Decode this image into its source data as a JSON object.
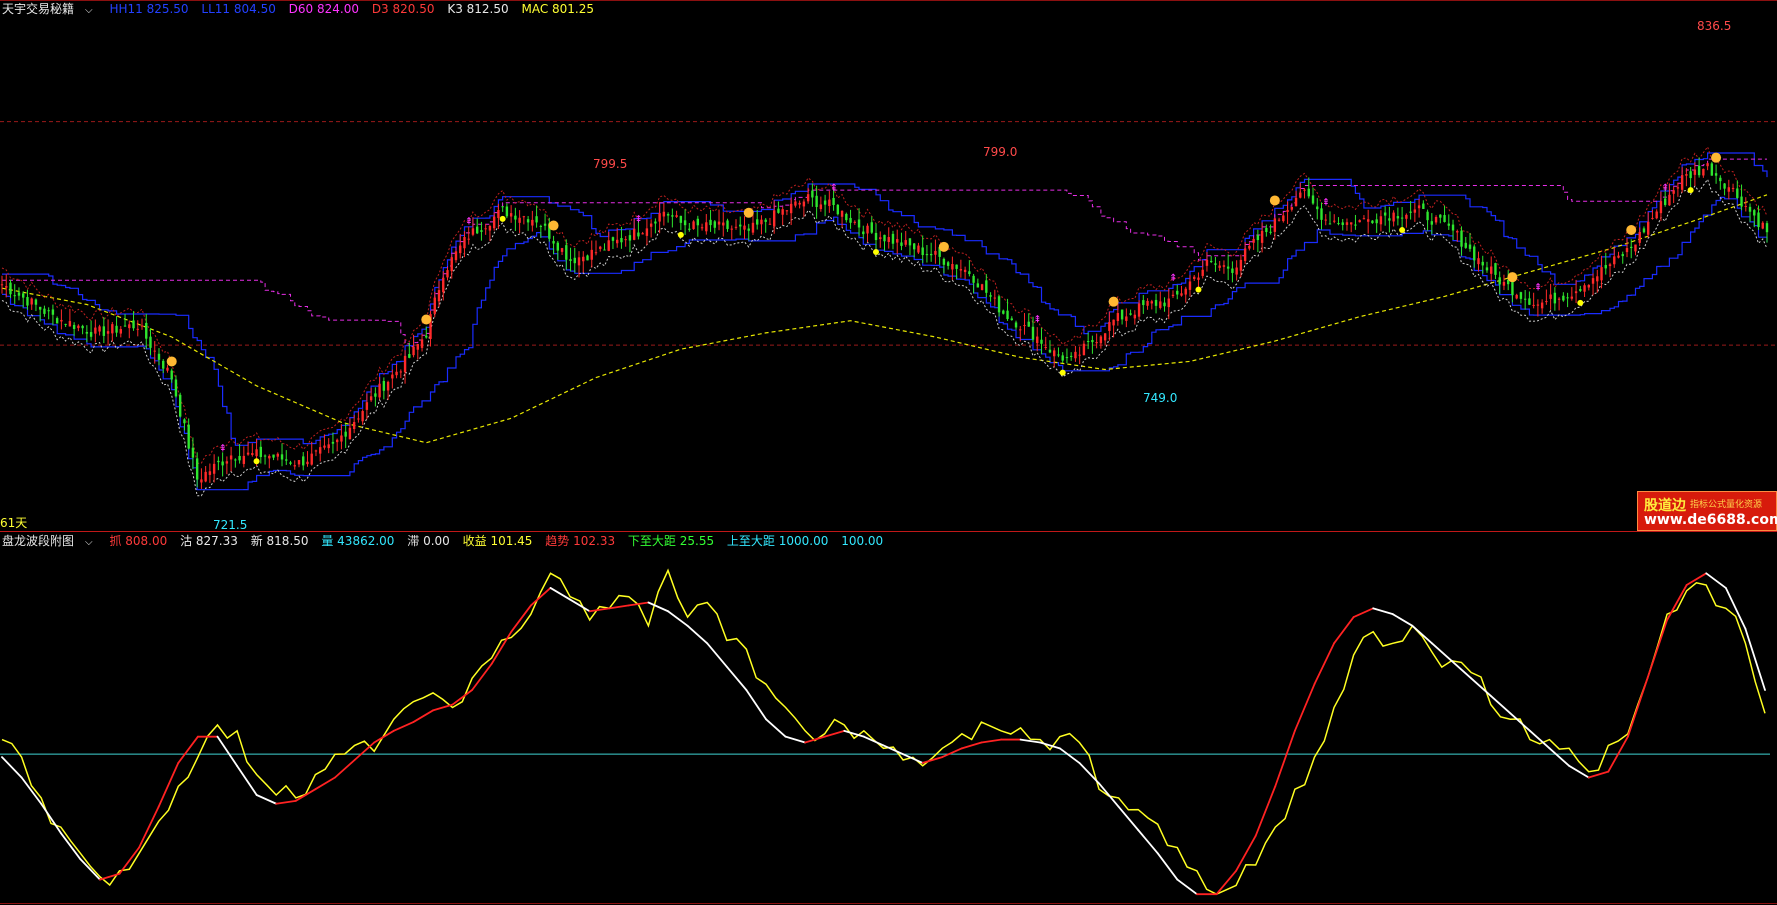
{
  "price_panel": {
    "title": "天宇交易秘籍",
    "indicators": [
      {
        "text": "HH11 825.50",
        "color": "#2340ff"
      },
      {
        "text": "LL11 804.50",
        "color": "#2340ff"
      },
      {
        "text": "D60 824.00",
        "color": "#ff33ff"
      },
      {
        "text": "D3 820.50",
        "color": "#ff3a3a"
      },
      {
        "text": "K3 812.50",
        "color": "#e8e8e8"
      },
      {
        "text": "MAC 801.25",
        "color": "#ffff33"
      }
    ],
    "price_labels": {
      "high_right": "836.5",
      "high_left": "799.5",
      "high_mid": "799.0",
      "low_mid": "749.0",
      "low_left": "721.5",
      "days": "61天"
    }
  },
  "indicator_panel": {
    "title": "盘龙波段附图",
    "indicators": [
      {
        "text": "抓 808.00",
        "color": "#ff3a3a"
      },
      {
        "text": "沽 827.33",
        "color": "#e8e8e8"
      },
      {
        "text": "新 818.50",
        "color": "#e8e8e8"
      },
      {
        "text": "量 43862.00",
        "color": "#33e8ff"
      },
      {
        "text": "滞 0.00",
        "color": "#e8e8e8"
      },
      {
        "text": "收益 101.45",
        "color": "#ffff33"
      },
      {
        "text": "趋势 102.33",
        "color": "#ff3a3a"
      },
      {
        "text": "下至大距 25.55",
        "color": "#33ff33"
      },
      {
        "text": "上至大距 1000.00",
        "color": "#33e8ff"
      },
      {
        "text": "100.00",
        "color": "#33e8ff"
      }
    ]
  },
  "watermark": {
    "brand": "股道边",
    "tagline": "指标公式量化资源",
    "url": "www.de6688.com"
  },
  "colors": {
    "background": "#000000",
    "up": "#ff2a2a",
    "down": "#2ee62e",
    "channel": "#1a2cff",
    "long_ma": "#e6e600",
    "d60": "#e62ee6",
    "indicator_fast": "#ffff22",
    "indicator_slow_up": "#ff2222",
    "indicator_slow_down": "#ffffff",
    "reference": "#3fd4d4"
  },
  "chart_data": [
    {
      "type": "line",
      "subtype": "candlestick",
      "ylim": [
        715,
        840
      ],
      "y_reference_lines": [
        815,
        760
      ],
      "marked_highs": [
        836.5,
        799.5,
        799.0
      ],
      "marked_lows": [
        721.5,
        749.0
      ],
      "series": [
        {
          "name": "HH11",
          "last": 825.5
        },
        {
          "name": "LL11",
          "last": 804.5
        },
        {
          "name": "D60",
          "last": 824.0
        },
        {
          "name": "D3",
          "last": 820.5
        },
        {
          "name": "K3",
          "last": 812.5
        },
        {
          "name": "MAC",
          "last": 801.25
        }
      ],
      "price_path": [
        [
          0,
          775
        ],
        [
          12,
          767
        ],
        [
          22,
          763
        ],
        [
          32,
          765
        ],
        [
          40,
          752
        ],
        [
          46,
          727
        ],
        [
          54,
          733
        ],
        [
          62,
          733
        ],
        [
          70,
          731
        ],
        [
          78,
          735
        ],
        [
          88,
          748
        ],
        [
          96,
          757
        ],
        [
          100,
          763
        ],
        [
          104,
          778
        ],
        [
          110,
          787
        ],
        [
          118,
          793
        ],
        [
          126,
          791
        ],
        [
          134,
          781
        ],
        [
          140,
          783
        ],
        [
          150,
          788
        ],
        [
          156,
          793
        ],
        [
          160,
          790
        ],
        [
          164,
          789
        ],
        [
          170,
          789
        ],
        [
          176,
          788
        ],
        [
          184,
          793
        ],
        [
          190,
          796
        ],
        [
          196,
          794
        ],
        [
          204,
          788
        ],
        [
          212,
          785
        ],
        [
          220,
          782
        ],
        [
          228,
          778
        ],
        [
          236,
          768
        ],
        [
          244,
          762
        ],
        [
          248,
          758
        ],
        [
          252,
          756
        ],
        [
          256,
          760
        ],
        [
          262,
          766
        ],
        [
          270,
          770
        ],
        [
          276,
          771
        ],
        [
          284,
          780
        ],
        [
          290,
          779
        ],
        [
          296,
          786
        ],
        [
          300,
          790
        ],
        [
          306,
          798
        ],
        [
          312,
          791
        ],
        [
          318,
          790
        ],
        [
          326,
          792
        ],
        [
          334,
          793
        ],
        [
          342,
          788
        ],
        [
          348,
          781
        ],
        [
          354,
          775
        ],
        [
          362,
          770
        ],
        [
          370,
          773
        ],
        [
          378,
          779
        ],
        [
          384,
          784
        ],
        [
          390,
          793
        ],
        [
          396,
          801
        ],
        [
          402,
          804
        ],
        [
          408,
          798
        ],
        [
          412,
          793
        ],
        [
          416,
          788
        ]
      ],
      "ma_path": [
        [
          0,
          774
        ],
        [
          20,
          770
        ],
        [
          40,
          762
        ],
        [
          60,
          750
        ],
        [
          80,
          741
        ],
        [
          100,
          736
        ],
        [
          120,
          742
        ],
        [
          140,
          752
        ],
        [
          160,
          759
        ],
        [
          180,
          763
        ],
        [
          200,
          766
        ],
        [
          220,
          762
        ],
        [
          240,
          757
        ],
        [
          260,
          754
        ],
        [
          280,
          756
        ],
        [
          300,
          761
        ],
        [
          320,
          767
        ],
        [
          340,
          772
        ],
        [
          360,
          778
        ],
        [
          380,
          784
        ],
        [
          400,
          791
        ],
        [
          416,
          797
        ]
      ]
    },
    {
      "type": "line",
      "title": "盘龙波段附图",
      "ylim": [
        0,
        120
      ],
      "reference_line": 50,
      "series": [
        {
          "name": "fast",
          "values": [
            55,
            49,
            35,
            25,
            16,
            8,
            10,
            16,
            27,
            39,
            49,
            60,
            58,
            43,
            36,
            35,
            43,
            50,
            53,
            51,
            62,
            68,
            71,
            66,
            76,
            83,
            90,
            98,
            112,
            104,
            96,
            100,
            104,
            94,
            113,
            97,
            102,
            89,
            86,
            74,
            66,
            58,
            57,
            60,
            58,
            52,
            48,
            46,
            52,
            57,
            61,
            58,
            59,
            55,
            56,
            54,
            38,
            35,
            31,
            26,
            18,
            10,
            2,
            5,
            12,
            25,
            38,
            49,
            66,
            84,
            92,
            88,
            94,
            85,
            82,
            78,
            67,
            62,
            55,
            55,
            52,
            44,
            53,
            57,
            76,
            98,
            106,
            108,
            100,
            88,
            64
          ]
        },
        {
          "name": "slow",
          "values": [
            49,
            42,
            33,
            23,
            14,
            7,
            9,
            18,
            32,
            47,
            56,
            56,
            46,
            36,
            33,
            34,
            38,
            42,
            48,
            54,
            58,
            61,
            65,
            67,
            72,
            81,
            92,
            101,
            107,
            103,
            99,
            100,
            101,
            102,
            99,
            94,
            88,
            80,
            72,
            62,
            56,
            54,
            56,
            58,
            56,
            53,
            50,
            47,
            49,
            52,
            54,
            55,
            55,
            54,
            52,
            47,
            40,
            32,
            24,
            16,
            7,
            2,
            2,
            10,
            22,
            39,
            58,
            74,
            88,
            97,
            100,
            98,
            94,
            88,
            82,
            76,
            70,
            64,
            58,
            52,
            46,
            42,
            44,
            56,
            76,
            96,
            108,
            112,
            107,
            93,
            72
          ]
        }
      ]
    }
  ]
}
